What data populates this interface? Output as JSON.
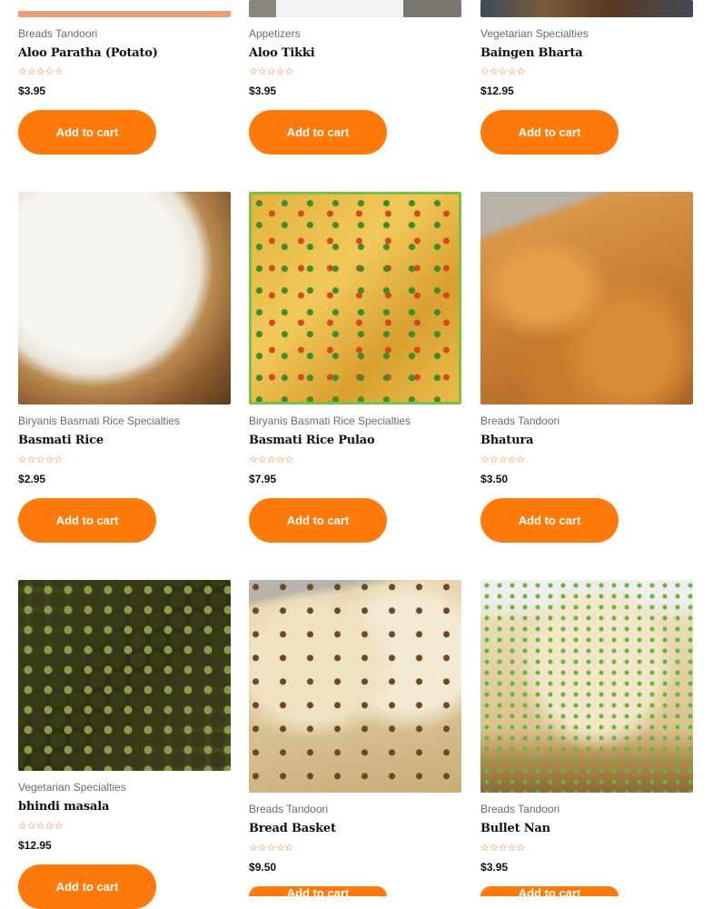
{
  "products": [
    {
      "category": "Breads Tandoori",
      "title": "Aloo Paratha (Potato)",
      "rating_stars": "☆☆☆☆☆",
      "currency": "$",
      "price": "3.95",
      "cta": "Add to cart"
    },
    {
      "category": "Appetizers",
      "title": "Aloo Tikki",
      "rating_stars": "☆☆☆☆☆",
      "currency": "$",
      "price": "3.95",
      "cta": "Add to cart"
    },
    {
      "category": "Vegetarian Specialties",
      "title": "Baingen Bharta",
      "rating_stars": "☆☆☆☆☆",
      "currency": "$",
      "price": "12.95",
      "cta": "Add to cart"
    },
    {
      "category": "Biryanis Basmati Rice Specialties",
      "title": "Basmati Rice",
      "rating_stars": "☆☆☆☆☆",
      "currency": "$",
      "price": "2.95",
      "cta": "Add to cart"
    },
    {
      "category": "Biryanis Basmati Rice Specialties",
      "title": "Basmati Rice Pulao",
      "rating_stars": "☆☆☆☆☆",
      "currency": "$",
      "price": "7.95",
      "cta": "Add to cart"
    },
    {
      "category": "Breads Tandoori",
      "title": "Bhatura",
      "rating_stars": "☆☆☆☆☆",
      "currency": "$",
      "price": "3.50",
      "cta": "Add to cart"
    },
    {
      "category": "Vegetarian Specialties",
      "title": "bhindi masala",
      "rating_stars": "☆☆☆☆☆",
      "currency": "$",
      "price": "12.95",
      "cta": "Add to cart"
    },
    {
      "category": "Breads Tandoori",
      "title": "Bread Basket",
      "rating_stars": "☆☆☆☆☆",
      "currency": "$",
      "price": "9.50",
      "cta": "Add to cart"
    },
    {
      "category": "Breads Tandoori",
      "title": "Bullet Nan",
      "rating_stars": "☆☆☆☆☆",
      "currency": "$",
      "price": "3.95",
      "cta": "Add to cart"
    }
  ]
}
